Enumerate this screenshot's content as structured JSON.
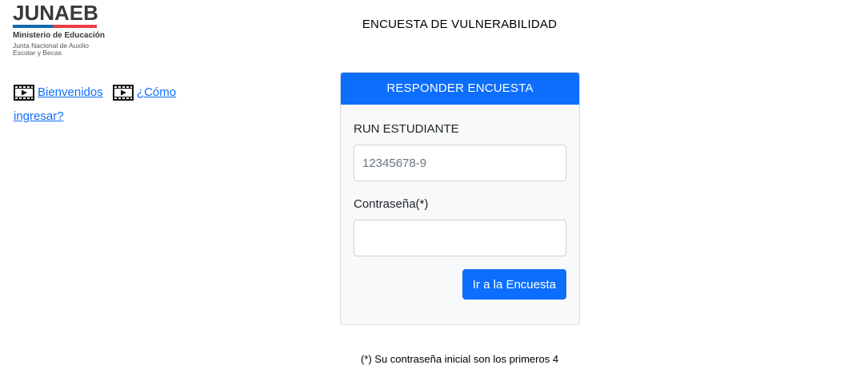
{
  "logo": {
    "word": "JUNAEB",
    "ministry": "Ministerio de Educación",
    "subtitle": "Junta Nacional de Auxilio Escolar y Becas",
    "colors": {
      "blue": "#0f69b4",
      "red": "#eb3c46"
    }
  },
  "header": {
    "title": "ENCUESTA DE VULNERABILIDAD"
  },
  "video_links": [
    {
      "icon": "film-icon",
      "label": "Bienvenidos"
    },
    {
      "icon": "film-icon",
      "label": "¿Cómo ingresar?"
    }
  ],
  "form": {
    "header": "RESPONDER ENCUESTA",
    "run_label": "RUN ESTUDIANTE",
    "run_placeholder": "12345678-9",
    "run_value": "",
    "password_label": "Contraseña(*)",
    "password_value": "",
    "submit_label": "Ir a la Encuesta"
  },
  "footnote": "(*) Su contraseña inicial son los primeros 4",
  "colors": {
    "primary": "#0d6efd",
    "card_bg": "#f8f9fa"
  }
}
